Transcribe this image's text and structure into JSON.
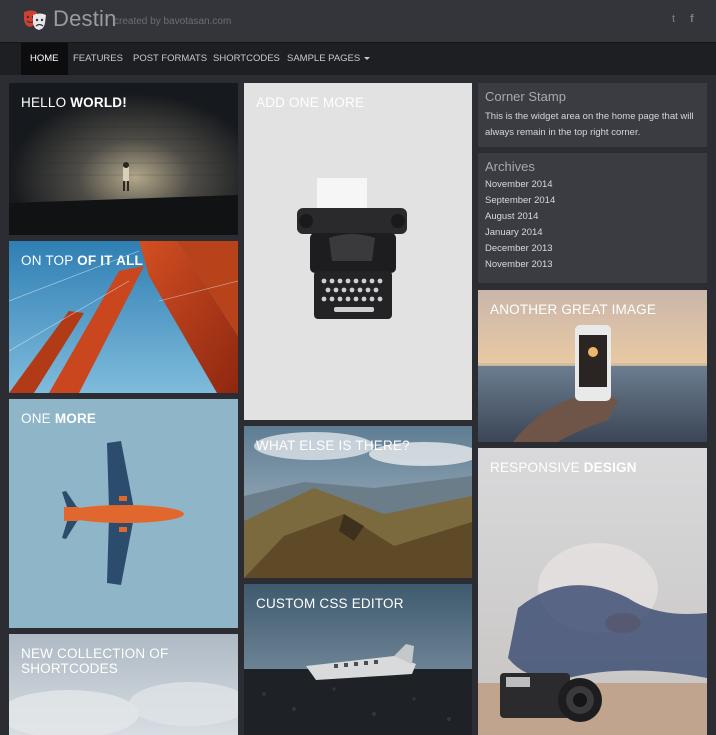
{
  "header": {
    "site_title": "Destin",
    "tagline": "created by bavotasan.com",
    "social": {
      "twitter_icon": "twitter-icon",
      "facebook_icon": "facebook-icon",
      "twitter_glyph": "t",
      "facebook_glyph": "f"
    }
  },
  "nav": {
    "items": [
      {
        "label": "Home"
      },
      {
        "label": "Features"
      },
      {
        "label": "Post Formats"
      },
      {
        "label": "Shortcodes"
      },
      {
        "label": "Sample Pages"
      }
    ]
  },
  "posts": [
    {
      "title_plain": "Hello ",
      "title_bold": "World!"
    },
    {
      "title_plain": "On top ",
      "title_bold": "of it all"
    },
    {
      "title_plain": "One ",
      "title_bold": "More"
    },
    {
      "title_plain": "New collection of shortcodes",
      "title_bold": ""
    },
    {
      "title_plain": "Add one more",
      "title_bold": ""
    },
    {
      "title_plain": "What else is there?",
      "title_bold": ""
    },
    {
      "title_plain": "Custom CSS Editor",
      "title_bold": ""
    },
    {
      "title_plain": "Another great image",
      "title_bold": ""
    },
    {
      "title_plain": "Responsive ",
      "title_bold": "Design"
    }
  ],
  "sidebar": {
    "corner_stamp": {
      "title": "Corner Stamp",
      "text": "This is the widget area on the home page that will always remain in the top right corner."
    },
    "archives": {
      "title": "Archives",
      "items": [
        "November 2014",
        "September 2014",
        "August 2014",
        "January 2014",
        "December 2013",
        "November 2013"
      ]
    }
  },
  "colors": {
    "background": "#2c2d33",
    "header": "#34353b",
    "nav": "#1e1f23",
    "widget": "#3b3c42",
    "logo_accent": "#d0402f"
  }
}
